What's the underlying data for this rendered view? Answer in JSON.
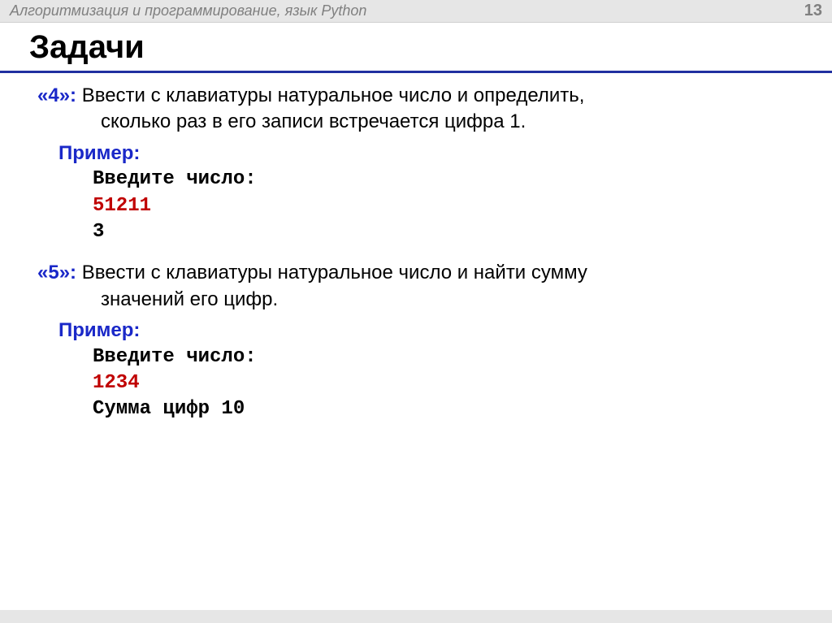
{
  "header": {
    "title": "Алгоритмизация и программирование, язык Python",
    "page_number": "13"
  },
  "slide": {
    "title": "Задачи"
  },
  "tasks": [
    {
      "label": "«4»:",
      "desc_first": "Ввести с клавиатуры натуральное число и определить,",
      "desc_second": "сколько  раз в его записи встречается цифра 1.",
      "example_label": "Пример:",
      "code": {
        "prompt": "Введите число:",
        "input": "51211",
        "output": "3"
      }
    },
    {
      "label": "«5»:",
      "desc_first": "Ввести с клавиатуры натуральное число и найти сумму",
      "desc_second": "значений его цифр.",
      "example_label": "Пример:",
      "code": {
        "prompt": "Введите число:",
        "input": "1234",
        "output": "Сумма цифр 10"
      }
    }
  ]
}
